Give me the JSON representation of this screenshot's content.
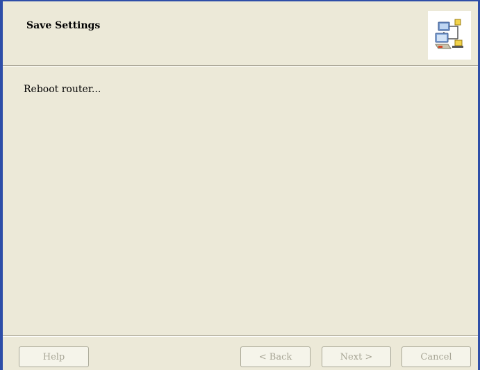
{
  "header": {
    "title": "Save Settings",
    "logo_icon": "network-computers-icon"
  },
  "body": {
    "message": "Reboot router..."
  },
  "footer": {
    "help_label": "Help",
    "back_label": "< Back",
    "next_label": "Next >",
    "cancel_label": "Cancel"
  },
  "colors": {
    "frame": "#2e4ea8",
    "panel": "#ece9d8",
    "disabled_text": "#a7a595"
  }
}
